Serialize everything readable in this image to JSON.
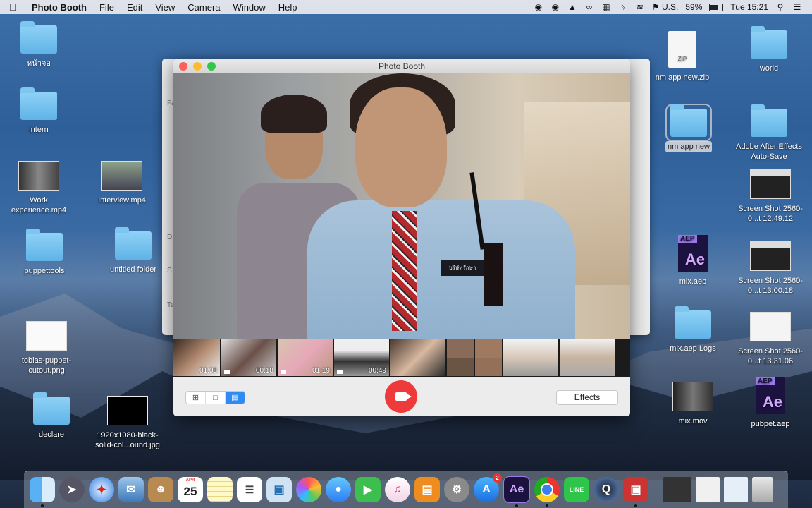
{
  "menubar": {
    "app_name": "Photo Booth",
    "menus": [
      "File",
      "Edit",
      "View",
      "Camera",
      "Window",
      "Help"
    ],
    "input_source": "U.S.",
    "battery": "59%",
    "battery_level": 0.59,
    "clock": "Tue 15:21"
  },
  "desktop_left": [
    {
      "label": "หน้าจอ",
      "kind": "folder"
    },
    {
      "label": "intern",
      "kind": "folder"
    },
    {
      "label": "Work experience.mp4",
      "kind": "video"
    },
    {
      "label": "Interview.mp4",
      "kind": "video"
    },
    {
      "label": "puppettools",
      "kind": "folder"
    },
    {
      "label": "untitled folder",
      "kind": "folder"
    },
    {
      "label": "tobias-puppet-cutout.png",
      "kind": "image"
    },
    {
      "label": "declare",
      "kind": "folder"
    },
    {
      "label": "1920x1080-black-solid-col...ound.jpg",
      "kind": "image"
    }
  ],
  "desktop_right": [
    {
      "label": "nm app new.zip",
      "kind": "zip"
    },
    {
      "label": "world",
      "kind": "folder"
    },
    {
      "label": "nm app new",
      "kind": "folder",
      "selected": true
    },
    {
      "label": "Adobe After Effects Auto-Save",
      "kind": "folder"
    },
    {
      "label": "Screen Shot 2560-0...t 12.49.12",
      "kind": "screenshot"
    },
    {
      "label": "mix.aep",
      "kind": "aep"
    },
    {
      "label": "Screen Shot 2560-0...t 13.00.18",
      "kind": "screenshot"
    },
    {
      "label": "mix.aep Logs",
      "kind": "folder"
    },
    {
      "label": "Screen Shot 2560-0...t 13.31.06",
      "kind": "screenshot"
    },
    {
      "label": "mix.mov",
      "kind": "video"
    },
    {
      "label": "pubpet.aep",
      "kind": "aep"
    }
  ],
  "behind_window": {
    "labels": [
      "Fa",
      "D",
      "S",
      "Ta"
    ]
  },
  "photobooth": {
    "title": "Photo Booth",
    "badge_text": "บริษัทรักษา",
    "filmstrip": [
      {
        "duration": "01:08"
      },
      {
        "duration": "00:18"
      },
      {
        "duration": "01:19"
      },
      {
        "duration": "00:49"
      },
      {
        "duration": ""
      },
      {
        "duration": ""
      },
      {
        "duration": ""
      },
      {
        "duration": ""
      }
    ],
    "effects_label": "Effects",
    "view_modes": [
      "grid",
      "single",
      "filmstrip"
    ],
    "active_view": "filmstrip"
  },
  "aep_tag": "AEP",
  "aep_letters": "Ae",
  "zip_tag": "ZIP",
  "dock": {
    "calendar_month": "APR",
    "calendar_day": "25",
    "appstore_badge": "2",
    "ae_letters": "Ae",
    "line_label": "LINE"
  }
}
